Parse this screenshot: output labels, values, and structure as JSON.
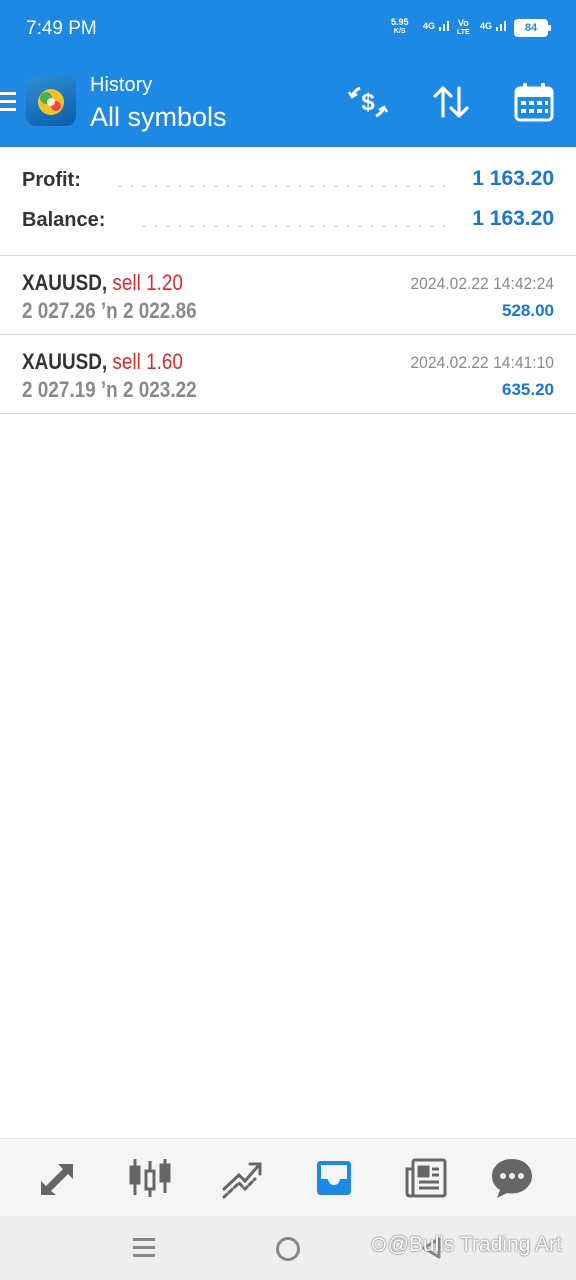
{
  "status_bar": {
    "time": "7:49 PM",
    "net_speed": "5.95",
    "net_unit": "K/S",
    "sig1": "4G",
    "volte_top": "Vo",
    "volte_bottom": "LTE",
    "sig2": "4G",
    "battery": "84"
  },
  "app_bar": {
    "subtitle": "History",
    "title": "All symbols"
  },
  "summary": {
    "profit_label": "Profit:",
    "profit_value": "1 163.20",
    "balance_label": "Balance:",
    "balance_value": "1 163.20"
  },
  "deals": [
    {
      "symbol": "XAUUSD,",
      "type": "sell 1.20",
      "prices": "2 027.26 ’n  2 022.86",
      "time": "2024.02.22 14:42:24",
      "profit": "528.00"
    },
    {
      "symbol": "XAUUSD,",
      "type": "sell 1.60",
      "prices": "2 027.19 ’n  2 023.22",
      "time": "2024.02.22 14:41:10",
      "profit": "635.20"
    }
  ],
  "bottom_nav": [
    "quotes-icon",
    "chart-icon",
    "trade-icon",
    "history-icon",
    "news-icon",
    "messages-icon"
  ],
  "watermark": "⊙@Bulls Trading Art",
  "colors": {
    "accent": "#1e88e5",
    "value_blue": "#1976d2",
    "sell_red": "#d32f2f"
  }
}
